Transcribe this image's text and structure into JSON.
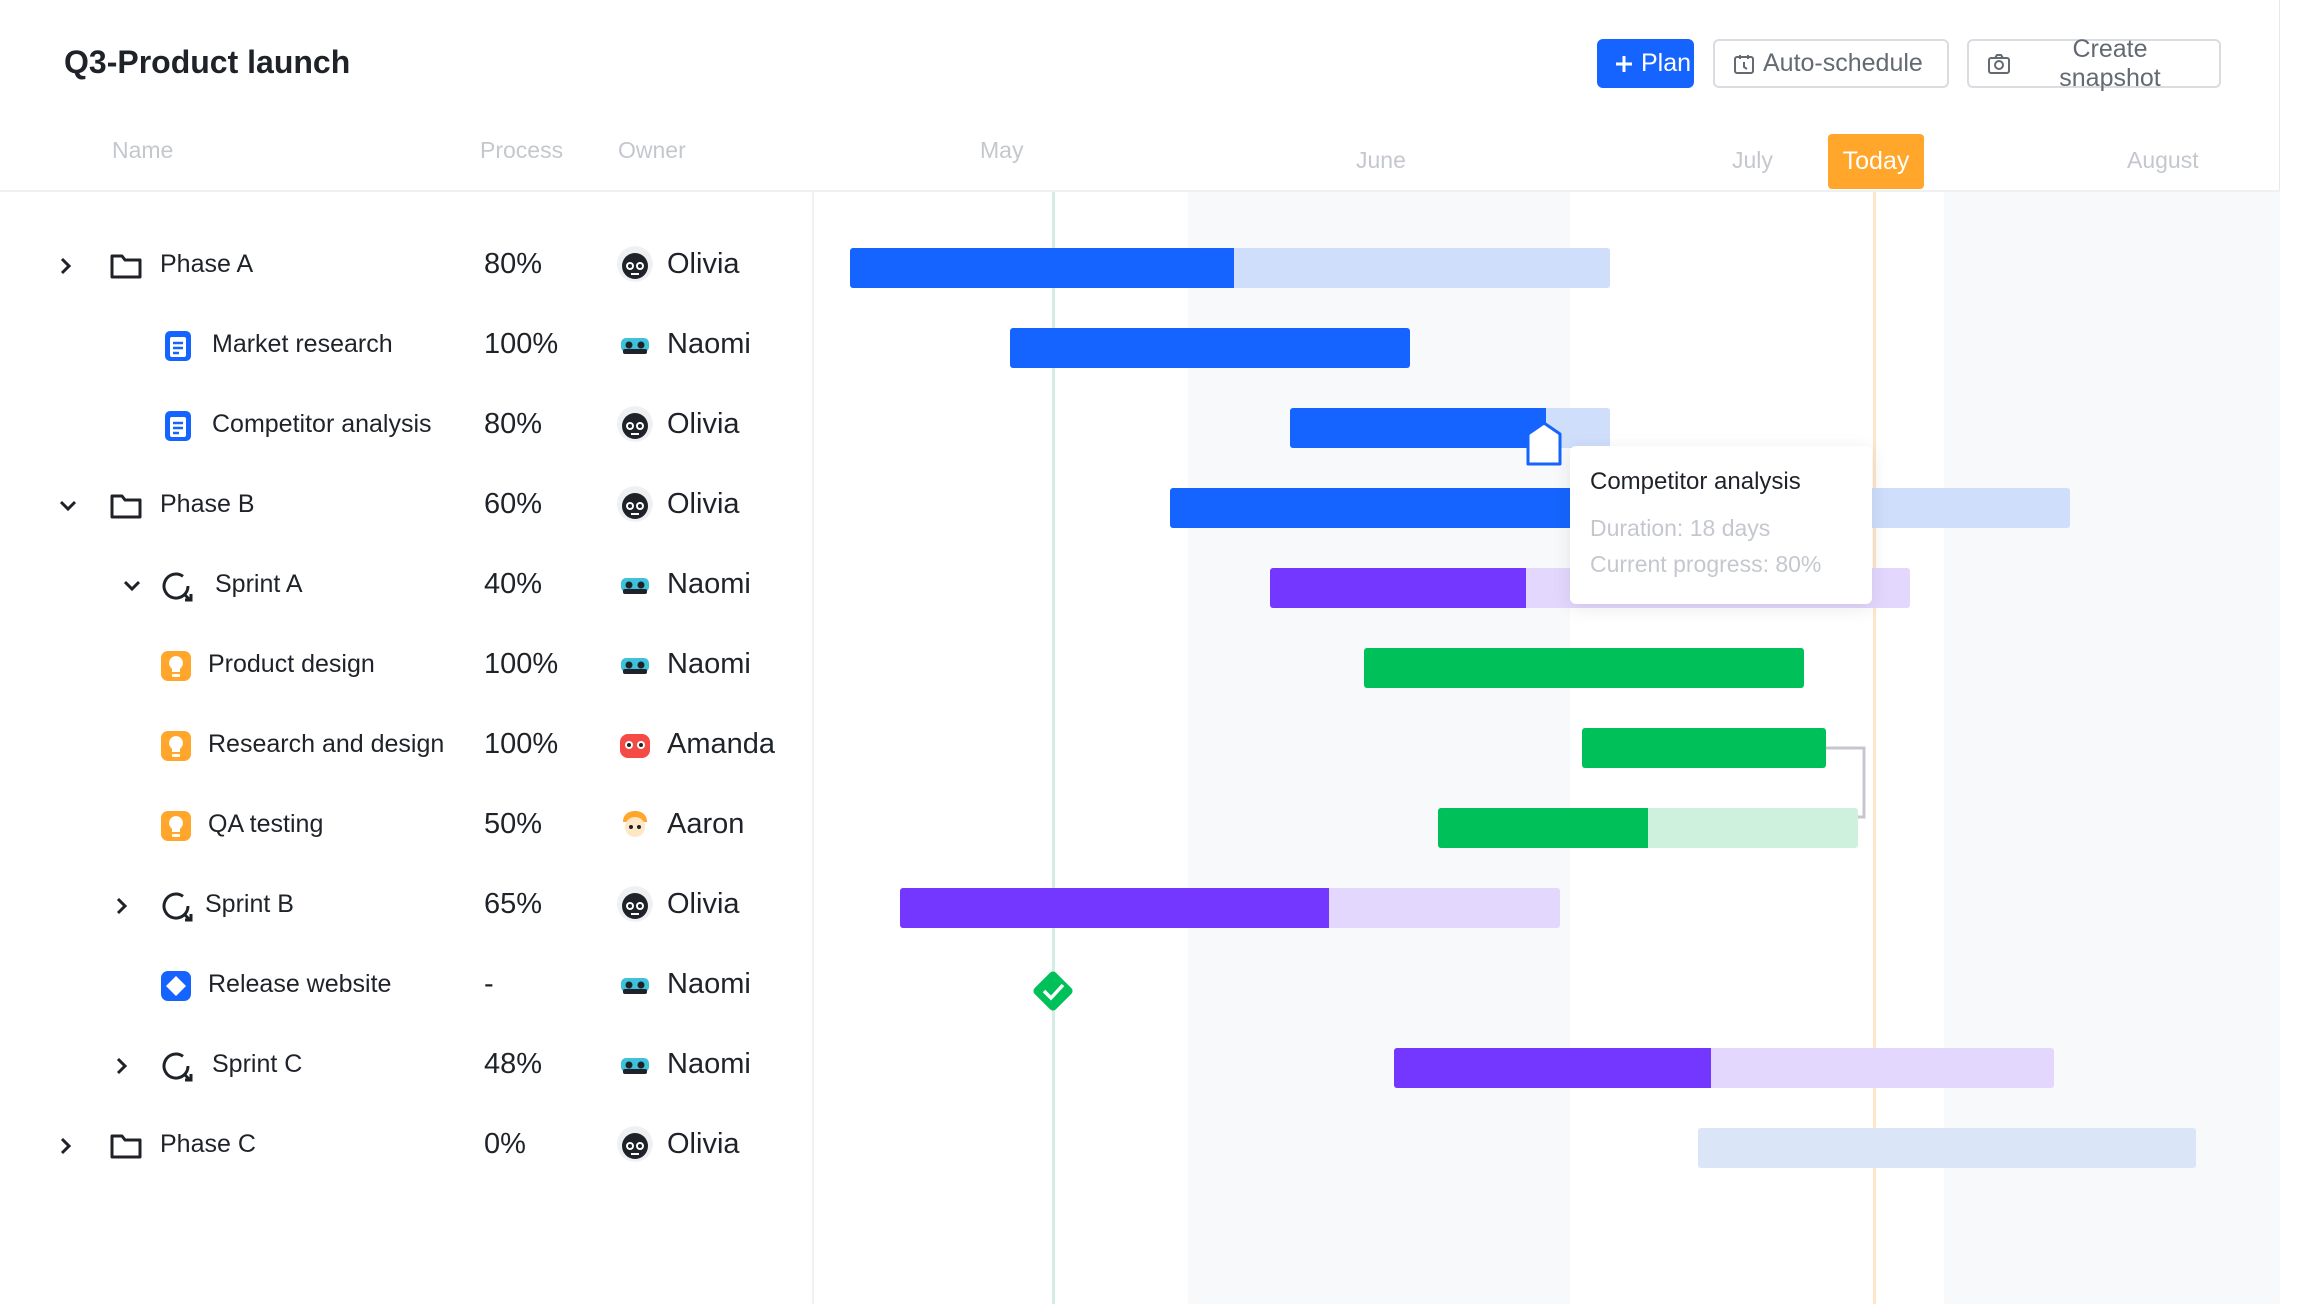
{
  "title": "Q3-Product launch",
  "toolbar": {
    "plan_label": "Plan",
    "auto_label": "Auto-schedule",
    "snapshot_label": "Create snapshot"
  },
  "columns": {
    "name": "Name",
    "process": "Process",
    "owner": "Owner"
  },
  "timeline": {
    "months": [
      "May",
      "June",
      "July",
      "August"
    ],
    "today_label": "Today"
  },
  "rows": [
    {
      "name": "Phase A",
      "process": "80%",
      "owner": "Olivia"
    },
    {
      "name": "Market research",
      "process": "100%",
      "owner": "Naomi"
    },
    {
      "name": "Competitor analysis",
      "process": "80%",
      "owner": "Olivia"
    },
    {
      "name": "Phase B",
      "process": "60%",
      "owner": "Olivia"
    },
    {
      "name": "Sprint A",
      "process": "40%",
      "owner": "Naomi"
    },
    {
      "name": "Product design",
      "process": "100%",
      "owner": "Naomi"
    },
    {
      "name": "Research and design",
      "process": "100%",
      "owner": "Amanda"
    },
    {
      "name": "QA testing",
      "process": "50%",
      "owner": "Aaron"
    },
    {
      "name": "Sprint B",
      "process": "65%",
      "owner": "Olivia"
    },
    {
      "name": "Release website",
      "process": "-",
      "owner": "Naomi"
    },
    {
      "name": "Sprint C",
      "process": "48%",
      "owner": "Naomi"
    },
    {
      "name": "Phase C",
      "process": "0%",
      "owner": "Olivia"
    }
  ],
  "tooltip": {
    "title": "Competitor analysis",
    "duration": "Duration: 18 days",
    "progress": "Current progress: 80%"
  },
  "colors": {
    "phase": "#1664ff",
    "phase_light": "#cfdffb",
    "sprint": "#7337ff",
    "sprint_light": "#e3d7fd",
    "design": "#00c05a",
    "design_light": "#cdf1dc",
    "today": "#ffa62b"
  }
}
